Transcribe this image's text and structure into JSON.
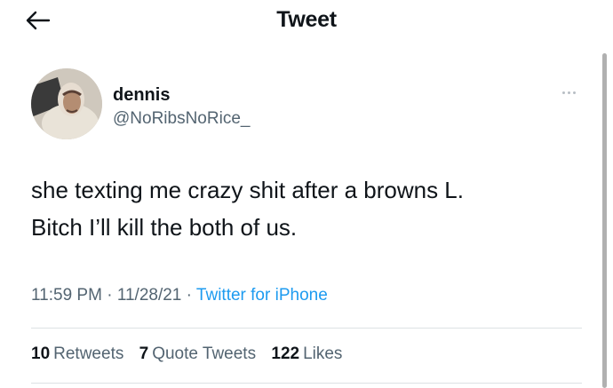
{
  "header": {
    "title": "Tweet",
    "back_icon": "arrow-left-icon"
  },
  "author": {
    "display_name": "dennis",
    "handle": "@NoRibsNoRice_",
    "avatar": "avatar-photo"
  },
  "more_icon": "more-horizontal-icon",
  "tweet": {
    "text_line1": "she texting me crazy shit after a browns L.",
    "text_line2": "Bitch I’ll kill the both of us."
  },
  "meta": {
    "time": "11:59 PM",
    "separator1": " · ",
    "date": "11/28/21",
    "separator2": " · ",
    "source": "Twitter for iPhone"
  },
  "stats": {
    "retweets_count": "10",
    "retweets_label": "Retweets",
    "quotes_count": "7",
    "quotes_label": "Quote Tweets",
    "likes_count": "122",
    "likes_label": "Likes"
  },
  "colors": {
    "text": "#0f1419",
    "secondary": "#536471",
    "link": "#1d9bf0",
    "divider": "#dde1e4"
  }
}
